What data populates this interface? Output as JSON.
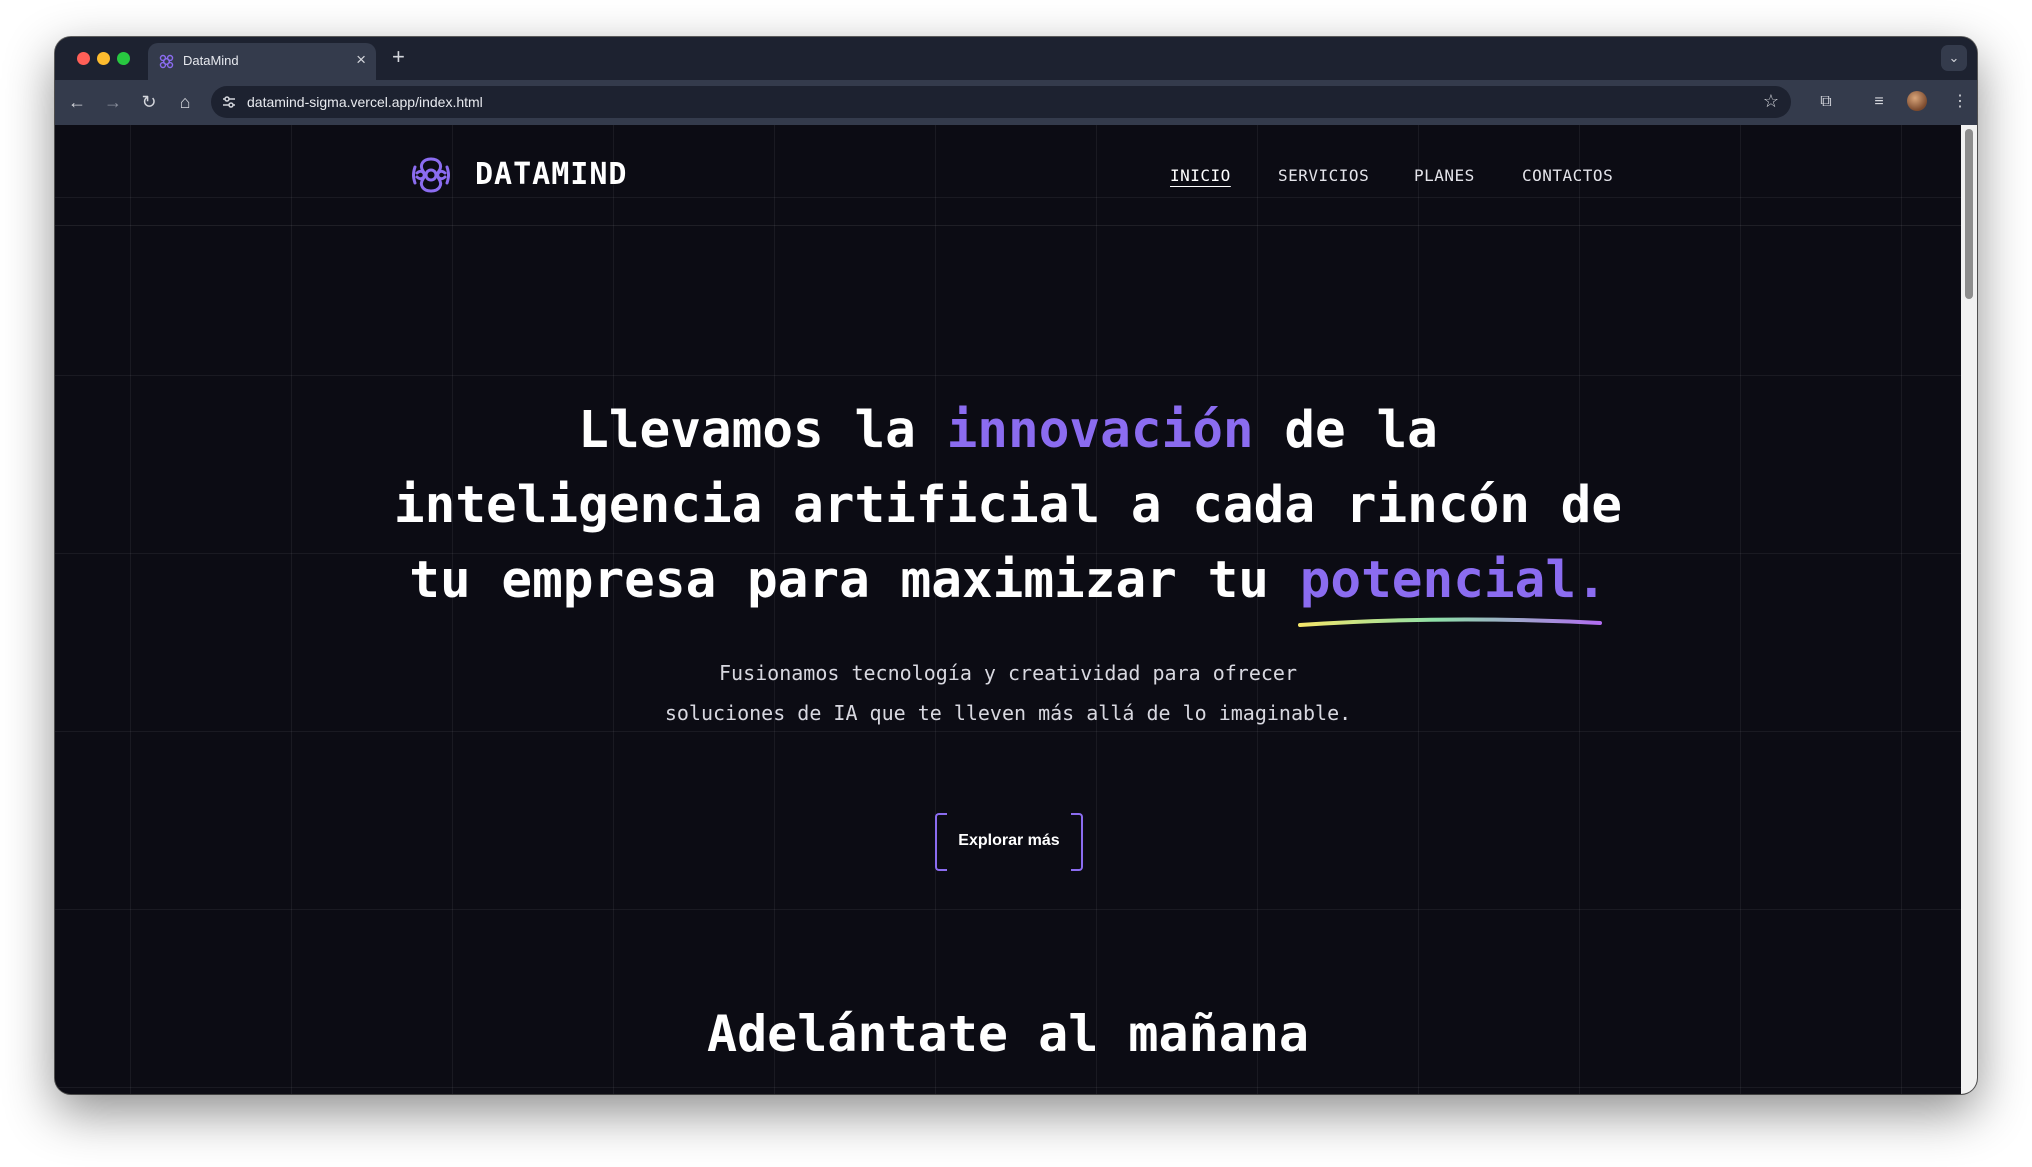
{
  "browser": {
    "tab_title": "DataMind",
    "url": "datamind-sigma.vercel.app/index.html",
    "new_tab_symbol": "+",
    "close_symbol": "×"
  },
  "site": {
    "logo_text": "DATAMIND",
    "accent_color": "#8b6cf0",
    "nav": [
      {
        "label": "INICIO",
        "active": true
      },
      {
        "label": "SERVICIOS",
        "active": false
      },
      {
        "label": "PLANES",
        "active": false
      },
      {
        "label": "CONTACTOS",
        "active": false
      }
    ]
  },
  "hero": {
    "line1_a": "Llevamos la ",
    "line1_accent": "innovación",
    "line1_b": " de la",
    "line2": "inteligencia artificial a cada rincón de",
    "line3_a": "tu empresa para maximizar tu ",
    "line3_accent": "potencial.",
    "sub_line1": "Fusionamos tecnología y creatividad para ofrecer",
    "sub_line2": "soluciones de IA que te lleven más allá de lo imaginable.",
    "cta": "Explorar más"
  },
  "section": {
    "title": "Adelántate al mañana"
  }
}
